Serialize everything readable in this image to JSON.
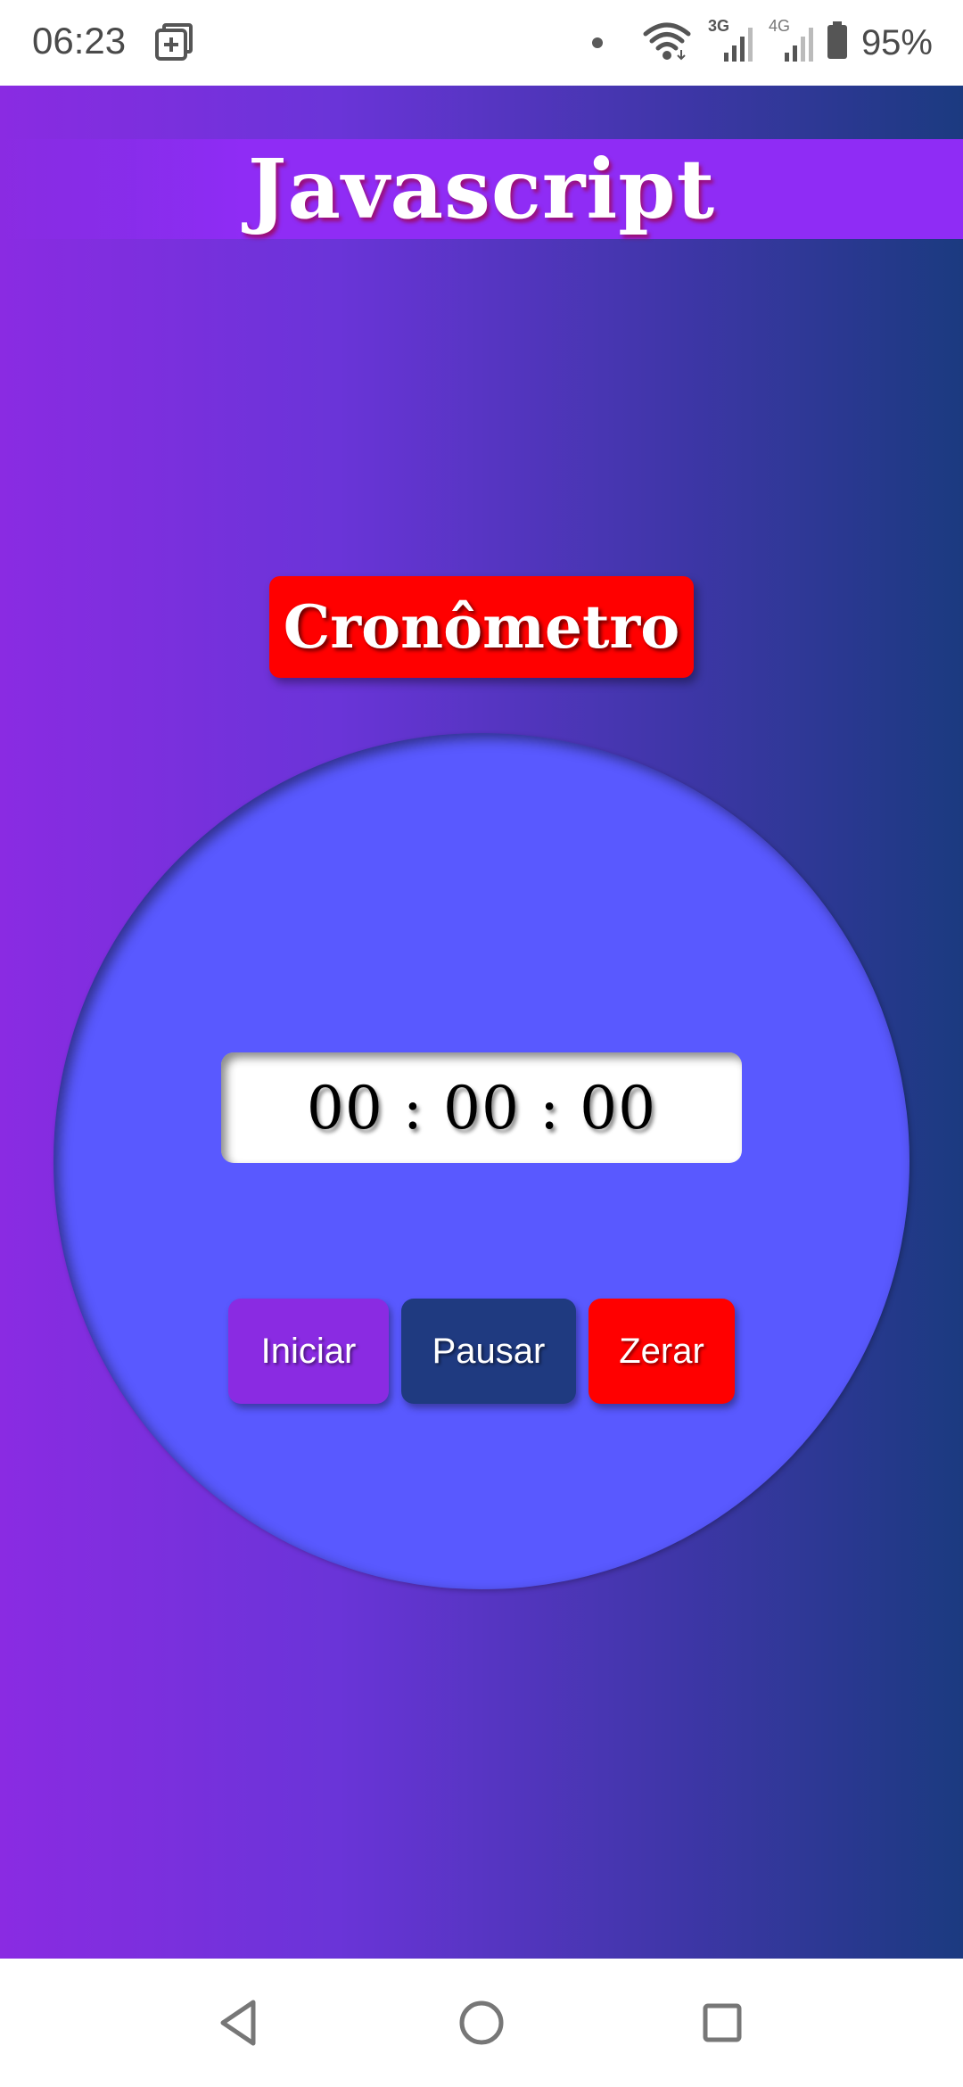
{
  "status_bar": {
    "time": "06:23",
    "battery_percent": "95%",
    "icons": [
      "app-notification-icon",
      "dot-icon",
      "wifi-icon",
      "signal-3g-icon",
      "signal-4g-icon",
      "battery-icon"
    ],
    "network_labels": [
      "3G",
      "4G"
    ]
  },
  "header": {
    "title": "Javascript"
  },
  "main": {
    "badge_title": "Cronômetro",
    "time_display": "00 : 00 : 00",
    "buttons": {
      "start_label": "Iniciar",
      "pause_label": "Pausar",
      "reset_label": "Zerar"
    }
  },
  "colors": {
    "gradient_start": "#8a2be2",
    "gradient_end": "#1b3a80",
    "circle": "#5959ff",
    "badge": "#ff0000",
    "start_button": "#8a2be2",
    "pause_button": "#1f3a80",
    "reset_button": "#ff0000"
  },
  "nav_bar": {
    "icons": [
      "back-icon",
      "home-icon",
      "recent-apps-icon"
    ]
  }
}
